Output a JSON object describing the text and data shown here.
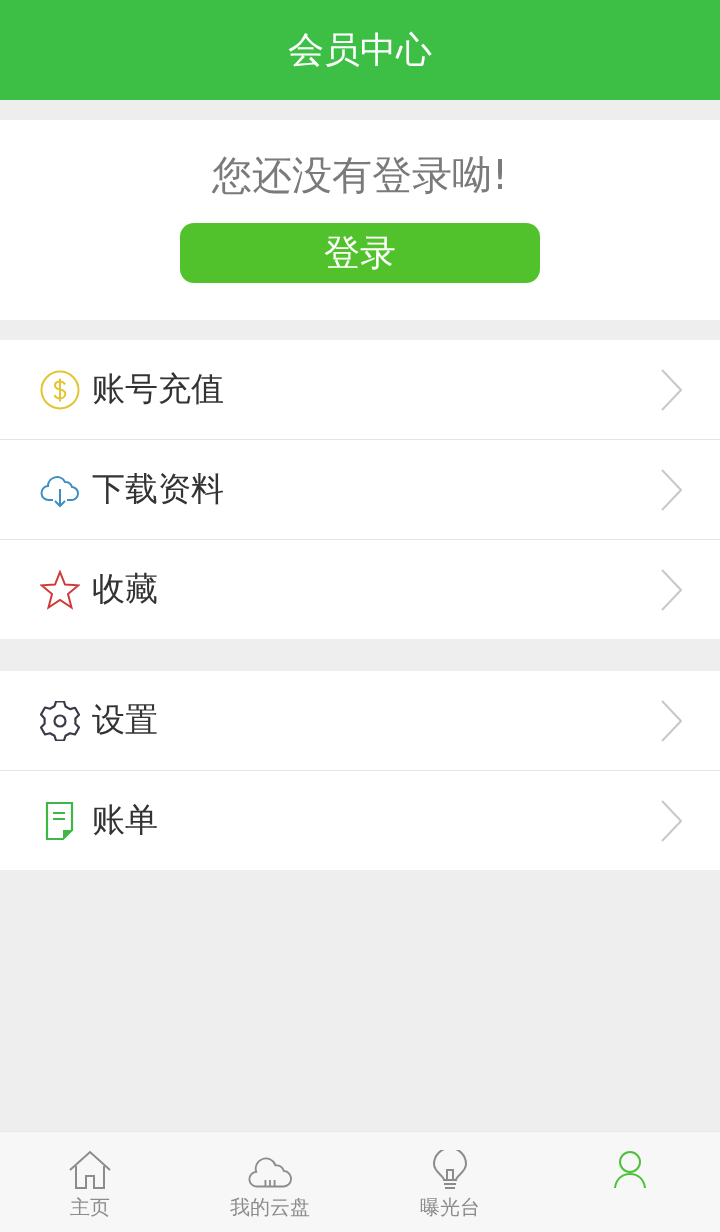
{
  "header": {
    "title": "会员中心"
  },
  "login": {
    "message": "您还没有登录呦!",
    "button": "登录"
  },
  "menu_groups": [
    {
      "items": [
        {
          "kind": "dollar",
          "label": "账号充值"
        },
        {
          "kind": "cloud-download",
          "label": "下载资料"
        },
        {
          "kind": "star",
          "label": "收藏"
        }
      ]
    },
    {
      "items": [
        {
          "kind": "gear",
          "label": "设置"
        },
        {
          "kind": "bill",
          "label": "账单"
        }
      ]
    }
  ],
  "tab_bar": [
    {
      "kind": "home",
      "label": "主页",
      "selected": false
    },
    {
      "kind": "cloud",
      "label": "我的云盘",
      "selected": false
    },
    {
      "kind": "bulb",
      "label": "曝光台",
      "selected": false
    },
    {
      "kind": "person",
      "selected": true
    }
  ]
}
